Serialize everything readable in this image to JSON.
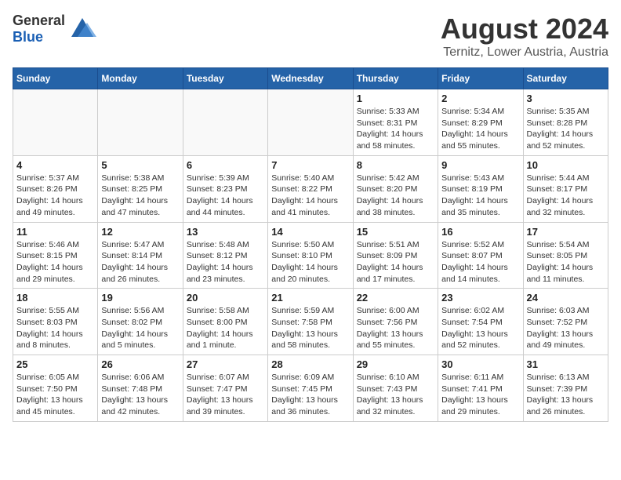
{
  "header": {
    "logo_general": "General",
    "logo_blue": "Blue",
    "title": "August 2024",
    "subtitle": "Ternitz, Lower Austria, Austria"
  },
  "weekdays": [
    "Sunday",
    "Monday",
    "Tuesday",
    "Wednesday",
    "Thursday",
    "Friday",
    "Saturday"
  ],
  "weeks": [
    [
      {
        "day": "",
        "info": ""
      },
      {
        "day": "",
        "info": ""
      },
      {
        "day": "",
        "info": ""
      },
      {
        "day": "",
        "info": ""
      },
      {
        "day": "1",
        "info": "Sunrise: 5:33 AM\nSunset: 8:31 PM\nDaylight: 14 hours\nand 58 minutes."
      },
      {
        "day": "2",
        "info": "Sunrise: 5:34 AM\nSunset: 8:29 PM\nDaylight: 14 hours\nand 55 minutes."
      },
      {
        "day": "3",
        "info": "Sunrise: 5:35 AM\nSunset: 8:28 PM\nDaylight: 14 hours\nand 52 minutes."
      }
    ],
    [
      {
        "day": "4",
        "info": "Sunrise: 5:37 AM\nSunset: 8:26 PM\nDaylight: 14 hours\nand 49 minutes."
      },
      {
        "day": "5",
        "info": "Sunrise: 5:38 AM\nSunset: 8:25 PM\nDaylight: 14 hours\nand 47 minutes."
      },
      {
        "day": "6",
        "info": "Sunrise: 5:39 AM\nSunset: 8:23 PM\nDaylight: 14 hours\nand 44 minutes."
      },
      {
        "day": "7",
        "info": "Sunrise: 5:40 AM\nSunset: 8:22 PM\nDaylight: 14 hours\nand 41 minutes."
      },
      {
        "day": "8",
        "info": "Sunrise: 5:42 AM\nSunset: 8:20 PM\nDaylight: 14 hours\nand 38 minutes."
      },
      {
        "day": "9",
        "info": "Sunrise: 5:43 AM\nSunset: 8:19 PM\nDaylight: 14 hours\nand 35 minutes."
      },
      {
        "day": "10",
        "info": "Sunrise: 5:44 AM\nSunset: 8:17 PM\nDaylight: 14 hours\nand 32 minutes."
      }
    ],
    [
      {
        "day": "11",
        "info": "Sunrise: 5:46 AM\nSunset: 8:15 PM\nDaylight: 14 hours\nand 29 minutes."
      },
      {
        "day": "12",
        "info": "Sunrise: 5:47 AM\nSunset: 8:14 PM\nDaylight: 14 hours\nand 26 minutes."
      },
      {
        "day": "13",
        "info": "Sunrise: 5:48 AM\nSunset: 8:12 PM\nDaylight: 14 hours\nand 23 minutes."
      },
      {
        "day": "14",
        "info": "Sunrise: 5:50 AM\nSunset: 8:10 PM\nDaylight: 14 hours\nand 20 minutes."
      },
      {
        "day": "15",
        "info": "Sunrise: 5:51 AM\nSunset: 8:09 PM\nDaylight: 14 hours\nand 17 minutes."
      },
      {
        "day": "16",
        "info": "Sunrise: 5:52 AM\nSunset: 8:07 PM\nDaylight: 14 hours\nand 14 minutes."
      },
      {
        "day": "17",
        "info": "Sunrise: 5:54 AM\nSunset: 8:05 PM\nDaylight: 14 hours\nand 11 minutes."
      }
    ],
    [
      {
        "day": "18",
        "info": "Sunrise: 5:55 AM\nSunset: 8:03 PM\nDaylight: 14 hours\nand 8 minutes."
      },
      {
        "day": "19",
        "info": "Sunrise: 5:56 AM\nSunset: 8:02 PM\nDaylight: 14 hours\nand 5 minutes."
      },
      {
        "day": "20",
        "info": "Sunrise: 5:58 AM\nSunset: 8:00 PM\nDaylight: 14 hours\nand 1 minute."
      },
      {
        "day": "21",
        "info": "Sunrise: 5:59 AM\nSunset: 7:58 PM\nDaylight: 13 hours\nand 58 minutes."
      },
      {
        "day": "22",
        "info": "Sunrise: 6:00 AM\nSunset: 7:56 PM\nDaylight: 13 hours\nand 55 minutes."
      },
      {
        "day": "23",
        "info": "Sunrise: 6:02 AM\nSunset: 7:54 PM\nDaylight: 13 hours\nand 52 minutes."
      },
      {
        "day": "24",
        "info": "Sunrise: 6:03 AM\nSunset: 7:52 PM\nDaylight: 13 hours\nand 49 minutes."
      }
    ],
    [
      {
        "day": "25",
        "info": "Sunrise: 6:05 AM\nSunset: 7:50 PM\nDaylight: 13 hours\nand 45 minutes."
      },
      {
        "day": "26",
        "info": "Sunrise: 6:06 AM\nSunset: 7:48 PM\nDaylight: 13 hours\nand 42 minutes."
      },
      {
        "day": "27",
        "info": "Sunrise: 6:07 AM\nSunset: 7:47 PM\nDaylight: 13 hours\nand 39 minutes."
      },
      {
        "day": "28",
        "info": "Sunrise: 6:09 AM\nSunset: 7:45 PM\nDaylight: 13 hours\nand 36 minutes."
      },
      {
        "day": "29",
        "info": "Sunrise: 6:10 AM\nSunset: 7:43 PM\nDaylight: 13 hours\nand 32 minutes."
      },
      {
        "day": "30",
        "info": "Sunrise: 6:11 AM\nSunset: 7:41 PM\nDaylight: 13 hours\nand 29 minutes."
      },
      {
        "day": "31",
        "info": "Sunrise: 6:13 AM\nSunset: 7:39 PM\nDaylight: 13 hours\nand 26 minutes."
      }
    ]
  ]
}
